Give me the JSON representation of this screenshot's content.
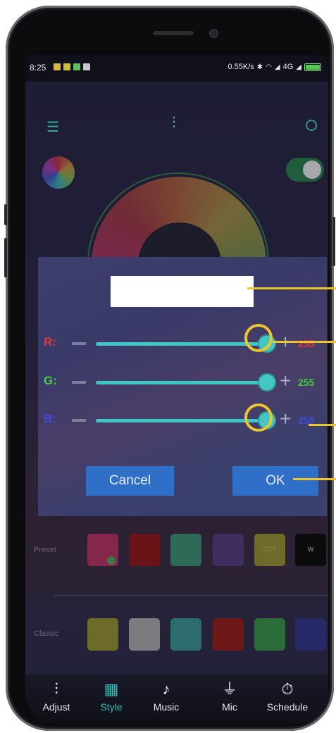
{
  "status_bar": {
    "time": "8:25",
    "network_speed": "0.55K/s",
    "network_type": "4G"
  },
  "header": {
    "menu_icon": "menu-icon",
    "title_icon": "equalizer-icon"
  },
  "dialog": {
    "name_value": "",
    "channels": [
      {
        "label": "R:",
        "value": "255",
        "color": "#e03a3a",
        "level": 1.0
      },
      {
        "label": "G:",
        "value": "255",
        "color": "#3fd03f",
        "level": 1.0
      },
      {
        "label": "B:",
        "value": "255",
        "color": "#3a4de0",
        "level": 1.0
      }
    ],
    "cancel_label": "Cancel",
    "ok_label": "OK"
  },
  "palettes": {
    "preset_label": "Preset",
    "preset_swatches": [
      {
        "color": "#86264a",
        "text": ""
      },
      {
        "color": "#6a1418",
        "text": ""
      },
      {
        "color": "#2e6a58",
        "text": ""
      },
      {
        "color": "#3e2f5e",
        "text": ""
      },
      {
        "color": "#6d6a2a",
        "text": "CCT"
      },
      {
        "color": "#0b0b0b",
        "text": "W"
      }
    ],
    "classic_label": "Classic",
    "classic_swatches": [
      {
        "color": "#6c6c28"
      },
      {
        "color": "#7c7c80"
      },
      {
        "color": "#2c6c6c"
      },
      {
        "color": "#6e1818"
      },
      {
        "color": "#2c6c38"
      },
      {
        "color": "#262a68"
      }
    ]
  },
  "bottom_nav": {
    "items": [
      {
        "label": "Adjust",
        "icon": "sliders-icon",
        "active": false
      },
      {
        "label": "Style",
        "icon": "grid-icon",
        "active": true
      },
      {
        "label": "Music",
        "icon": "music-icon",
        "active": false
      },
      {
        "label": "Mic",
        "icon": "mic-icon",
        "active": false
      },
      {
        "label": "Schedule",
        "icon": "timer-icon",
        "active": false
      }
    ]
  },
  "colors": {
    "accent": "#3fc7c5",
    "button_blue": "#2f6fc7",
    "callout_yellow": "#ecc52a"
  }
}
